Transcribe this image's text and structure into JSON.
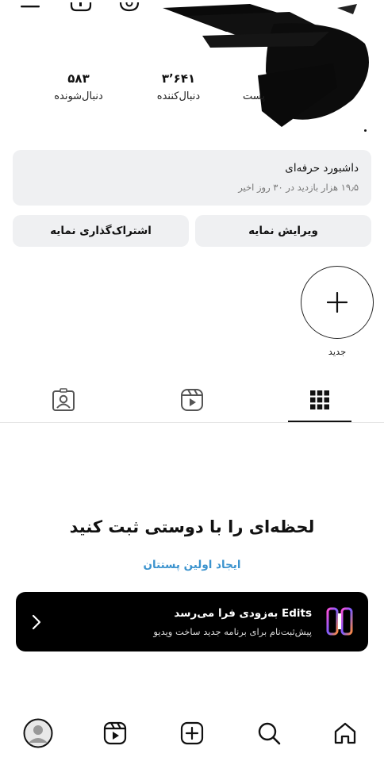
{
  "stats": [
    {
      "value": "",
      "label": "پست"
    },
    {
      "value": "۳٬۶۴۱",
      "label": "دنبال‌کننده"
    },
    {
      "value": "۵۸۳",
      "label": "دنبال‌شونده"
    }
  ],
  "dashboard": {
    "title": "داشبورد حرفه‌ای",
    "subtitle": "۱۹٫۵ هزار بازدید در ۳۰ روز اخیر"
  },
  "buttons": {
    "edit_profile": "ویرایش نمایه",
    "share_profile": "اشتراک‌گذاری نمایه"
  },
  "highlight": {
    "new_label": "جدید"
  },
  "tabs": [
    {
      "name": "grid",
      "icon": "grid-icon",
      "active": true
    },
    {
      "name": "reels",
      "icon": "reels-icon",
      "active": false
    },
    {
      "name": "tagged",
      "icon": "tagged-icon",
      "active": false
    }
  ],
  "empty_state": {
    "title": "لحظه‌ای را با دوستی ثبت کنید",
    "link": "ایجاد اولین پستتان"
  },
  "edits_banner": {
    "title": "Edits به‌زودی فرا می‌رسد",
    "subtitle": "پیش‌ثبت‌نام برای برنامه جدید ساخت ویدیو"
  },
  "bottom_nav": [
    "home-icon",
    "search-icon",
    "create-icon",
    "reels-icon",
    "profile-icon"
  ],
  "colors": {
    "accent_link": "#3b93ce",
    "card_bg": "#eff0f2",
    "banner_bg": "#000000"
  }
}
